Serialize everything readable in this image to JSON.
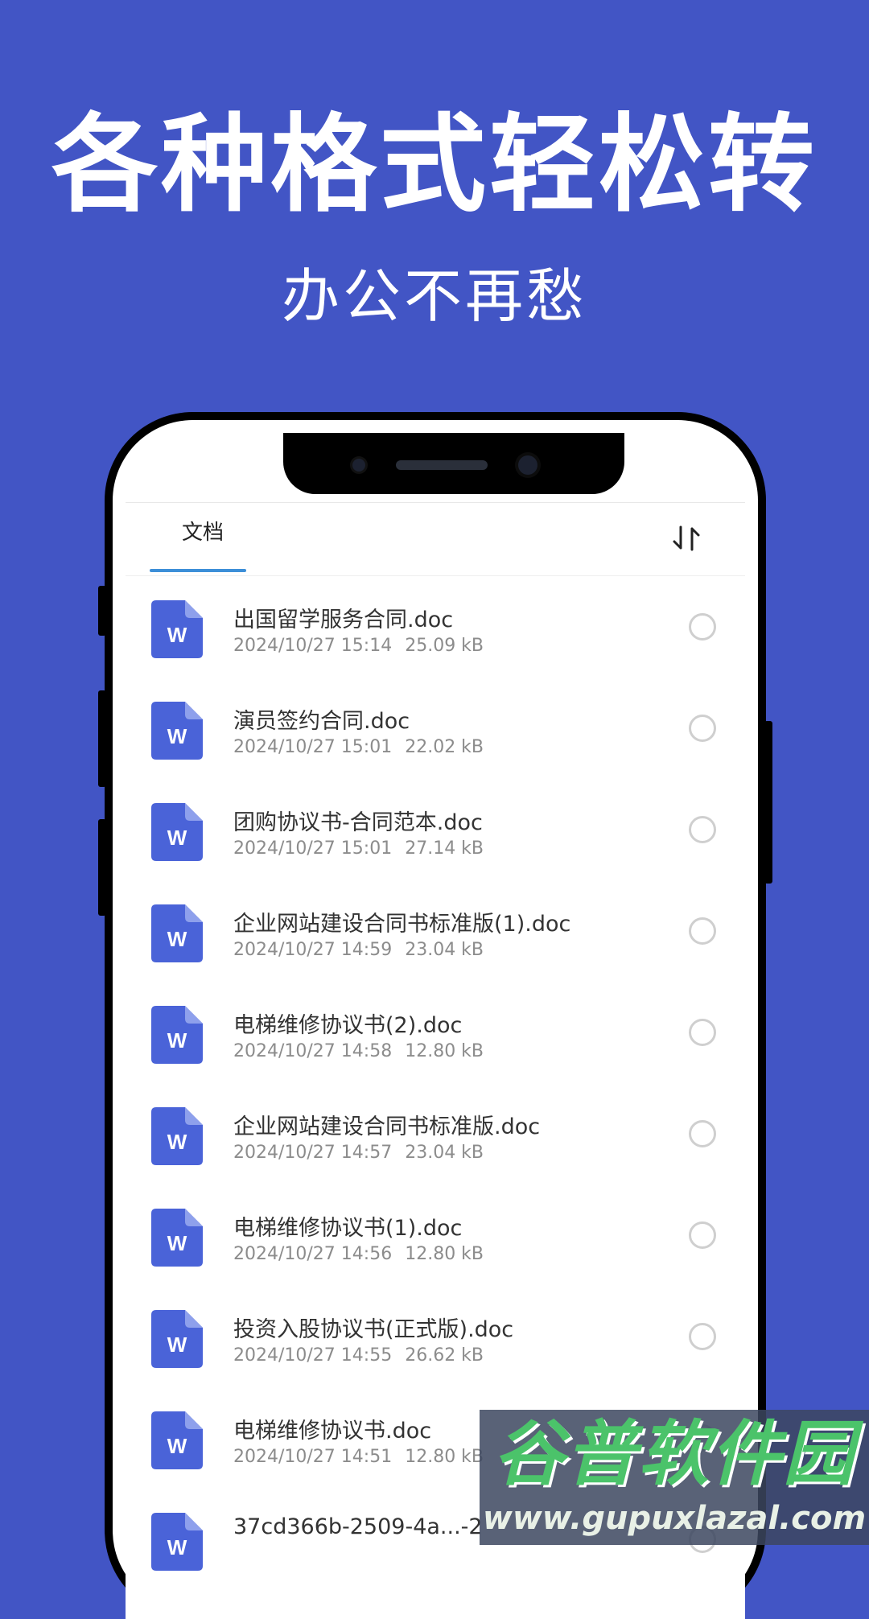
{
  "promo": {
    "headline": "各种格式轻松转",
    "subheadline": "办公不再愁"
  },
  "app": {
    "tab_label": "文档",
    "sort_icon": "sort-icon",
    "files": [
      {
        "name": "出国留学服务合同.doc",
        "date": "2024/10/27 15:14",
        "size": "25.09 kB"
      },
      {
        "name": "演员签约合同.doc",
        "date": "2024/10/27 15:01",
        "size": "22.02 kB"
      },
      {
        "name": "团购协议书-合同范本.doc",
        "date": "2024/10/27 15:01",
        "size": "27.14 kB"
      },
      {
        "name": "企业网站建设合同书标准版(1).doc",
        "date": "2024/10/27 14:59",
        "size": "23.04 kB"
      },
      {
        "name": "电梯维修协议书(2).doc",
        "date": "2024/10/27 14:58",
        "size": "12.80 kB"
      },
      {
        "name": "企业网站建设合同书标准版.doc",
        "date": "2024/10/27 14:57",
        "size": "23.04 kB"
      },
      {
        "name": "电梯维修协议书(1).doc",
        "date": "2024/10/27 14:56",
        "size": "12.80 kB"
      },
      {
        "name": "投资入股协议书(正式版).doc",
        "date": "2024/10/27 14:55",
        "size": "26.62 kB"
      },
      {
        "name": "电梯维修协议书.doc",
        "date": "2024/10/27 14:51",
        "size": "12.80 kB"
      },
      {
        "name": "37cd366b-2509-4a...-2",
        "date": "",
        "size": ""
      }
    ],
    "icon_letter": "W"
  },
  "watermark": {
    "brand": "谷普软件园",
    "url": "www.gupuxlazal.com"
  },
  "colors": {
    "background": "#4255C5",
    "word_icon": "#4A63D8",
    "tab_accent": "#3D8FD8"
  }
}
